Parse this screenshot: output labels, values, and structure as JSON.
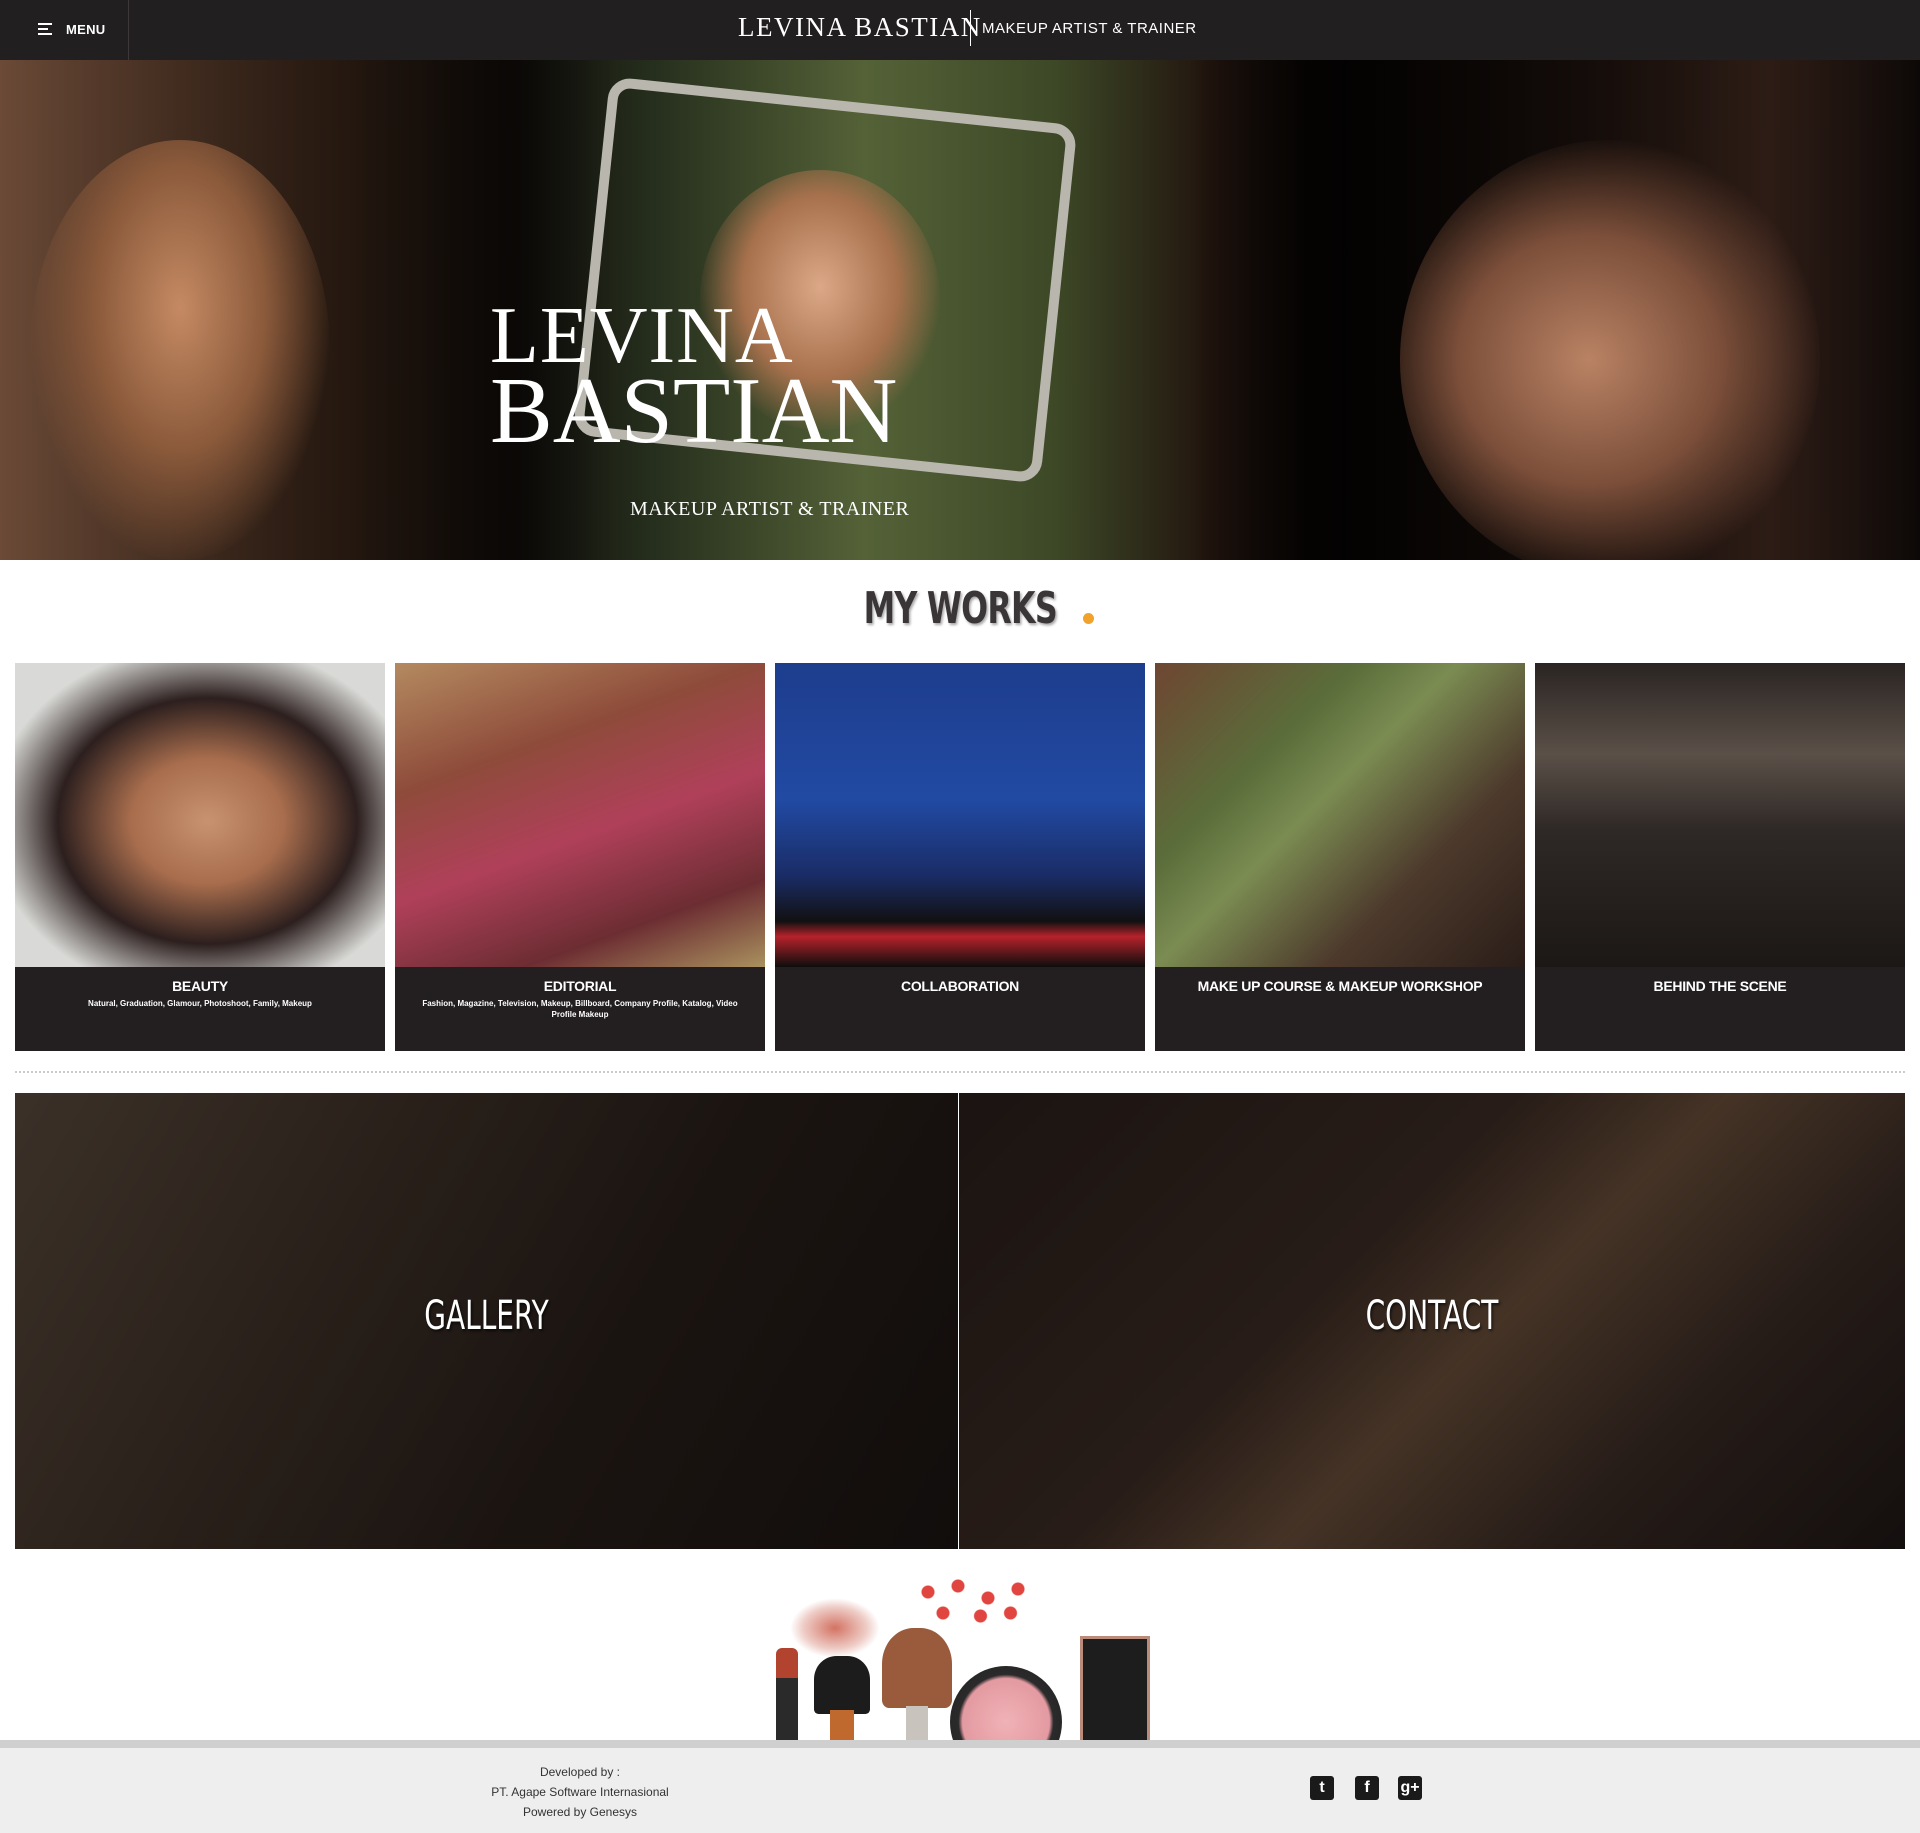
{
  "header": {
    "menu_label": "MENU",
    "brand_name": "LEVINA BASTIAN",
    "brand_tagline": "MAKEUP ARTIST & TRAINER"
  },
  "hero": {
    "title_line1": "LEVINA",
    "title_line2": "BASTIAN",
    "subtitle": "MAKEUP ARTIST & TRAINER"
  },
  "works": {
    "title": "MY WORKS",
    "accent_color": "#f0a22a",
    "cards": [
      {
        "title": "BEAUTY",
        "description": "Natural, Graduation, Glamour, Photoshoot, Family, Makeup"
      },
      {
        "title": "EDITORIAL",
        "description": "Fashion, Magazine, Television, Makeup, Billboard, Company Profile, Katalog, Video Profile Makeup"
      },
      {
        "title": "COLLABORATION",
        "description": ""
      },
      {
        "title": "MAKE UP COURSE & MAKEUP WORKSHOP",
        "description": ""
      },
      {
        "title": "BEHIND THE SCENE",
        "description": ""
      }
    ]
  },
  "tiles": {
    "gallery_label": "GALLERY",
    "contact_label": "CONTACT"
  },
  "footer": {
    "developed_by": "Developed by :",
    "company": "PT. Agape Software Internasional",
    "powered_by": "Powered by Genesys",
    "social": {
      "twitter_glyph": "t",
      "facebook_glyph": "f",
      "googleplus_glyph": "g+"
    }
  },
  "colors": {
    "topbar_bg": "#221f20",
    "card_bg": "#231f20",
    "footer_bg": "#eeeeee"
  }
}
